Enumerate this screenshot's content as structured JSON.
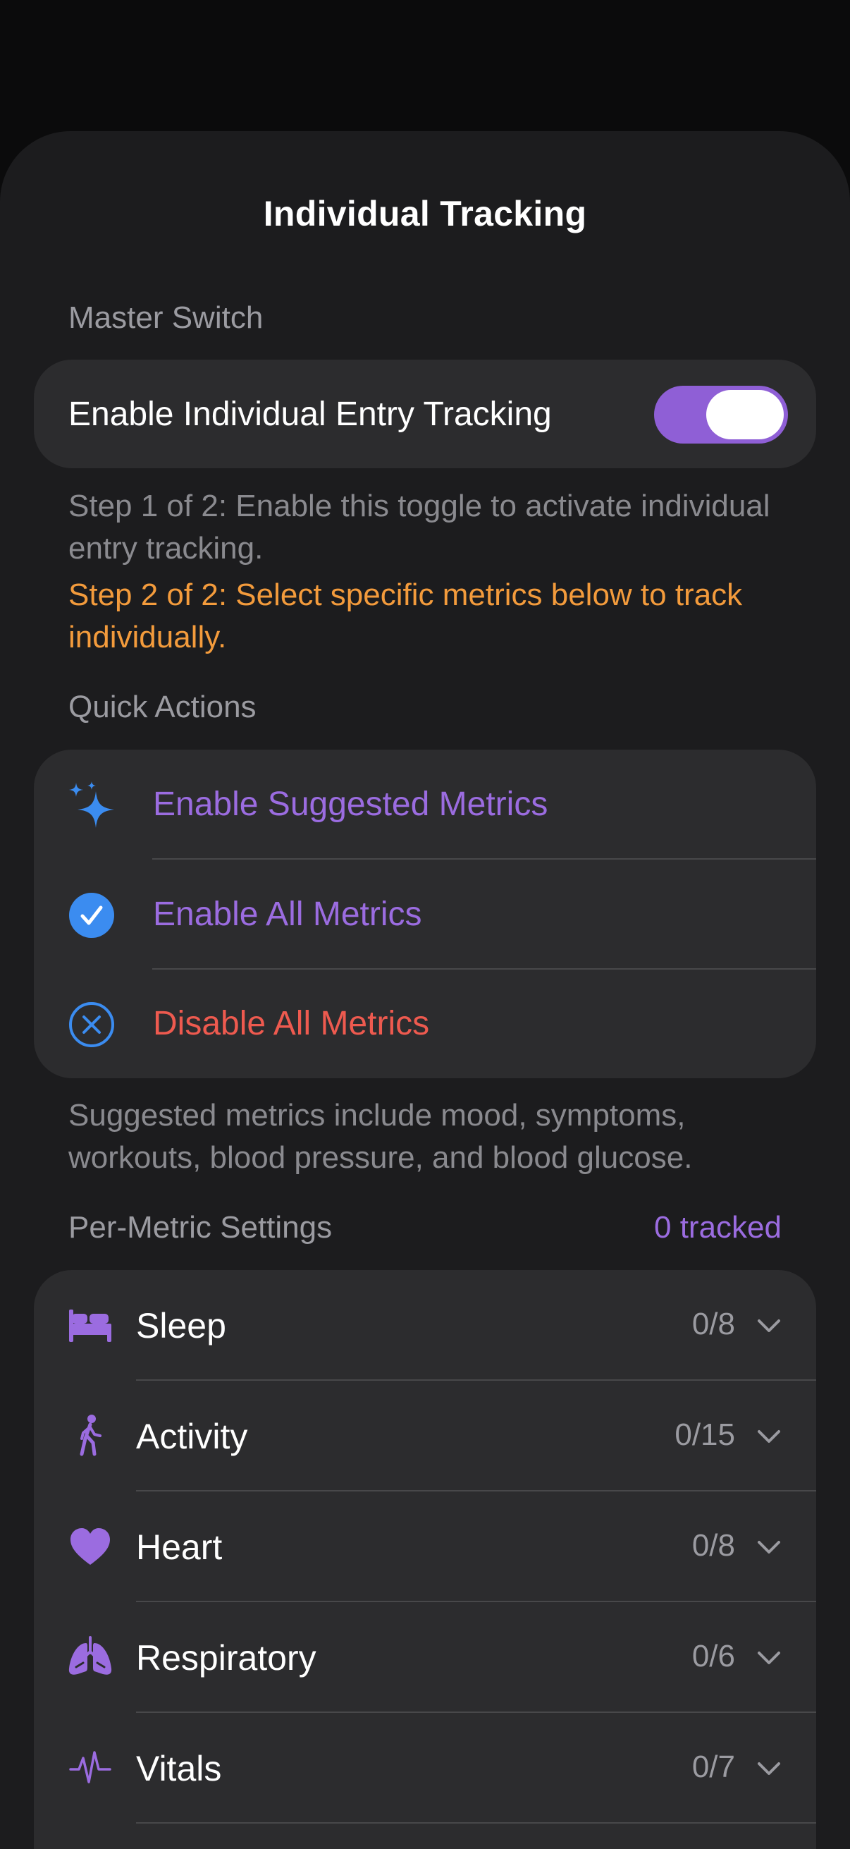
{
  "sheet": {
    "title": "Individual Tracking"
  },
  "master": {
    "header": "Master Switch",
    "toggle_label": "Enable Individual Entry Tracking",
    "toggle_on": true,
    "step1": "Step 1 of 2: Enable this toggle to activate individual entry tracking.",
    "step2": "Step 2 of 2: Select specific metrics below to track individually."
  },
  "quick_actions": {
    "header": "Quick Actions",
    "items": [
      {
        "label": "Enable Suggested Metrics",
        "icon": "sparkles-icon",
        "color": "#9b6ce0"
      },
      {
        "label": "Enable All Metrics",
        "icon": "checkmark-circle-fill-icon",
        "color": "#9b6ce0"
      },
      {
        "label": "Disable All Metrics",
        "icon": "xmark-circle-icon",
        "color": "#ee5a4f"
      }
    ],
    "footnote": "Suggested metrics include mood, symptoms, workouts, blood pressure, and blood glucose."
  },
  "metrics": {
    "header": "Per-Metric Settings",
    "tracked": "0 tracked",
    "items": [
      {
        "label": "Sleep",
        "count": "0/8",
        "icon": "bed-icon"
      },
      {
        "label": "Activity",
        "count": "0/15",
        "icon": "walking-figure-icon"
      },
      {
        "label": "Heart",
        "count": "0/8",
        "icon": "heart-icon"
      },
      {
        "label": "Respiratory",
        "count": "0/6",
        "icon": "lungs-icon"
      },
      {
        "label": "Vitals",
        "count": "0/7",
        "icon": "waveform-icon"
      }
    ]
  },
  "colors": {
    "accent_purple": "#9b6ce0",
    "toggle_on": "#8f5fd6",
    "warning_orange": "#f39b3c",
    "destructive_red": "#ee5a4f",
    "icon_blue": "#3b8cf0"
  }
}
